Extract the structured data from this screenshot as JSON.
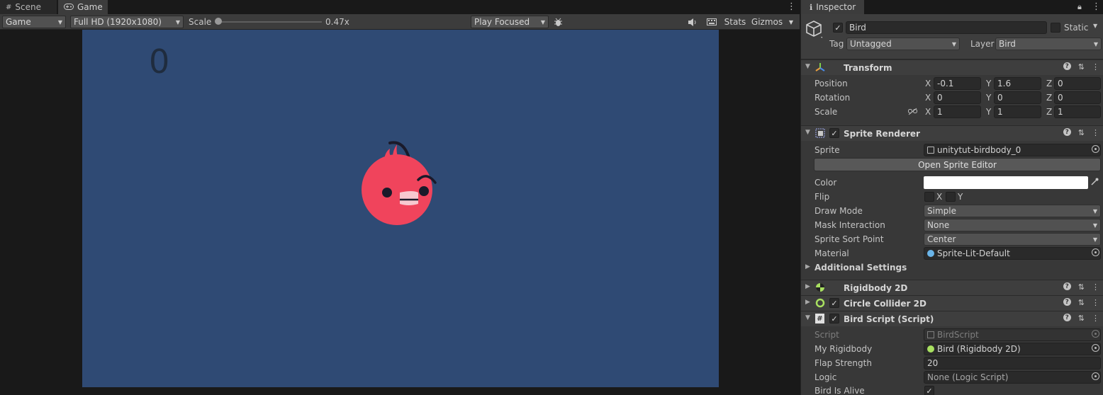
{
  "scene_tabs": {
    "scene_label": "Scene",
    "game_label": "Game"
  },
  "game_toolbar": {
    "display": "Game",
    "resolution": "Full HD (1920x1080)",
    "scale_label": "Scale",
    "scale_value": "0.47x",
    "play_mode": "Play Focused",
    "stats_label": "Stats",
    "gizmos_label": "Gizmos"
  },
  "game_view": {
    "score": "0",
    "background_color": "#2f4a74"
  },
  "inspector": {
    "tab_label": "Inspector",
    "object": {
      "name": "Bird",
      "active": true,
      "static_label": "Static",
      "tag_label": "Tag",
      "tag_value": "Untagged",
      "layer_label": "Layer",
      "layer_value": "Bird"
    },
    "transform": {
      "title": "Transform",
      "position_label": "Position",
      "rotation_label": "Rotation",
      "scale_label": "Scale",
      "x": "X",
      "y": "Y",
      "z": "Z",
      "position": {
        "x": "-0.1",
        "y": "1.6",
        "z": "0"
      },
      "rotation": {
        "x": "0",
        "y": "0",
        "z": "0"
      },
      "scale": {
        "x": "1",
        "y": "1",
        "z": "1"
      }
    },
    "sprite_renderer": {
      "title": "Sprite Renderer",
      "sprite_label": "Sprite",
      "sprite_value": "unitytut-birdbody_0",
      "open_editor_label": "Open Sprite Editor",
      "color_label": "Color",
      "flip_label": "Flip",
      "flip_x": "X",
      "flip_y": "Y",
      "draw_mode_label": "Draw Mode",
      "draw_mode_value": "Simple",
      "mask_label": "Mask Interaction",
      "mask_value": "None",
      "sort_point_label": "Sprite Sort Point",
      "sort_point_value": "Center",
      "material_label": "Material",
      "material_value": "Sprite-Lit-Default",
      "additional_label": "Additional Settings"
    },
    "rigidbody": {
      "title": "Rigidbody 2D"
    },
    "circle_collider": {
      "title": "Circle Collider 2D"
    },
    "bird_script": {
      "title": "Bird Script (Script)",
      "script_label": "Script",
      "script_value": "BirdScript",
      "rigidbody_label": "My Rigidbody",
      "rigidbody_value": "Bird (Rigidbody 2D)",
      "flap_label": "Flap Strength",
      "flap_value": "20",
      "logic_label": "Logic",
      "logic_value": "None (Logic Script)",
      "alive_label": "Bird Is Alive"
    },
    "colors": {
      "accent_green": "#a8e060",
      "bird_red": "#f0445c"
    }
  }
}
